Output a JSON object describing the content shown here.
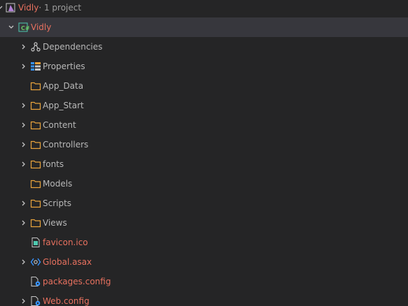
{
  "solution": {
    "name": "Vidly",
    "suffix": " · 1 project"
  },
  "project": {
    "name": "Vidly"
  },
  "items": [
    {
      "label": "Dependencies"
    },
    {
      "label": "Properties"
    },
    {
      "label": "App_Data"
    },
    {
      "label": "App_Start"
    },
    {
      "label": "Content"
    },
    {
      "label": "Controllers"
    },
    {
      "label": "fonts"
    },
    {
      "label": "Models"
    },
    {
      "label": "Scripts"
    },
    {
      "label": "Views"
    },
    {
      "label": "favicon.ico"
    },
    {
      "label": "Global.asax"
    },
    {
      "label": "packages.config"
    },
    {
      "label": "Web.config"
    }
  ],
  "colors": {
    "accent": "#e8715f",
    "folder": "#e8a33c",
    "background": "#252526",
    "selected": "#37373d"
  }
}
